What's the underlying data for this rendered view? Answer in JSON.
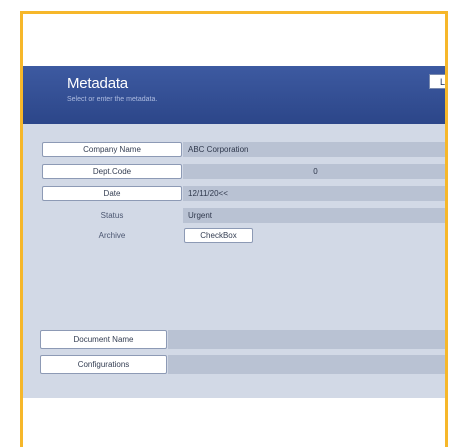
{
  "header": {
    "title": "Metadata",
    "subtitle": "Select or enter the metadata.",
    "top_button_label": "Lo"
  },
  "fields": {
    "company_name": {
      "label": "Company Name",
      "value": "ABC Corporation"
    },
    "dept_code": {
      "label": "Dept.Code",
      "value": "0"
    },
    "date": {
      "label": "Date",
      "value": "12/11/20<<"
    },
    "status": {
      "label": "Status",
      "value": "Urgent"
    },
    "archive": {
      "label": "Archive",
      "button_label": "CheckBox"
    }
  },
  "lower_fields": {
    "document_name": {
      "label": "Document Name",
      "value": ""
    },
    "configurations": {
      "label": "Configurations",
      "value": ""
    }
  },
  "colors": {
    "frame_border": "#f6b72a",
    "header_bg": "#2c4689",
    "panel_bg": "#d2d9e6",
    "value_bg": "#b9c2d3"
  }
}
